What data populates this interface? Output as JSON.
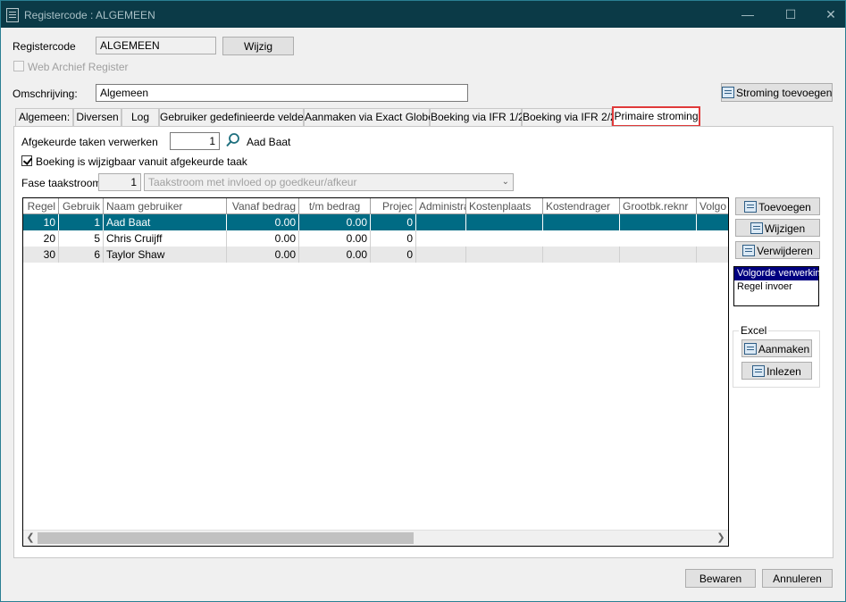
{
  "window": {
    "title": "Registercode : ALGEMEEN",
    "minimize": "—",
    "maximize": "☐",
    "close": "✕"
  },
  "header": {
    "registercode_label": "Registercode",
    "registercode_value": "ALGEMEEN",
    "wijzig_label": "Wijzig",
    "web_archief_label": "Web Archief Register",
    "omschrijving_label": "Omschrijving:",
    "omschrijving_value": "Algemeen",
    "stroming_toevoegen_label": "Stroming toevoegen"
  },
  "tabs": [
    {
      "label": "Algemeen:"
    },
    {
      "label": "Diversen"
    },
    {
      "label": "Log"
    },
    {
      "label": "Gebruiker gedefinieerde velden"
    },
    {
      "label": "Aanmaken via Exact Globe"
    },
    {
      "label": "Boeking via IFR 1/2"
    },
    {
      "label": "Boeking via IFR 2/2"
    },
    {
      "label": "Primaire stroming"
    }
  ],
  "active_tab": "Primaire stroming",
  "primaire": {
    "afgekeurde_label": "Afgekeurde taken verwerken",
    "afgekeurde_value": "1",
    "afgekeurde_user": "Aad Baat",
    "boeking_wijzigbaar_label": "Boeking is wijzigbaar vanuit afgekeurde taak",
    "fase_label": "Fase taakstroom:",
    "fase_value": "1",
    "fase_select": "Taakstroom met invloed op goedkeur/afkeur"
  },
  "grid": {
    "columns": [
      "Regel",
      "Gebruik",
      "Naam gebruiker",
      "Vanaf bedrag",
      "t/m bedrag",
      "Projec",
      "Administra",
      "Kostenplaats",
      "Kostendrager",
      "Grootbk.reknr",
      "Volgo"
    ],
    "rows": [
      {
        "regel": "10",
        "gebruiker": "1",
        "naam": "Aad Baat",
        "vanaf": "0.00",
        "tm": "0.00",
        "project": "0"
      },
      {
        "regel": "20",
        "gebruiker": "5",
        "naam": "Chris Cruijff",
        "vanaf": "0.00",
        "tm": "0.00",
        "project": "0"
      },
      {
        "regel": "30",
        "gebruiker": "6",
        "naam": "Taylor Shaw",
        "vanaf": "0.00",
        "tm": "0.00",
        "project": "0"
      }
    ]
  },
  "side": {
    "toevoegen": "Toevoegen",
    "wijzigen": "Wijzigen",
    "verwijderen": "Verwijderen",
    "order_options": [
      "Volgorde verwerking",
      "Regel invoer"
    ],
    "excel_label": "Excel",
    "aanmaken": "Aanmaken",
    "inlezen": "Inlezen"
  },
  "footer": {
    "bewaren": "Bewaren",
    "annuleren": "Annuleren"
  }
}
